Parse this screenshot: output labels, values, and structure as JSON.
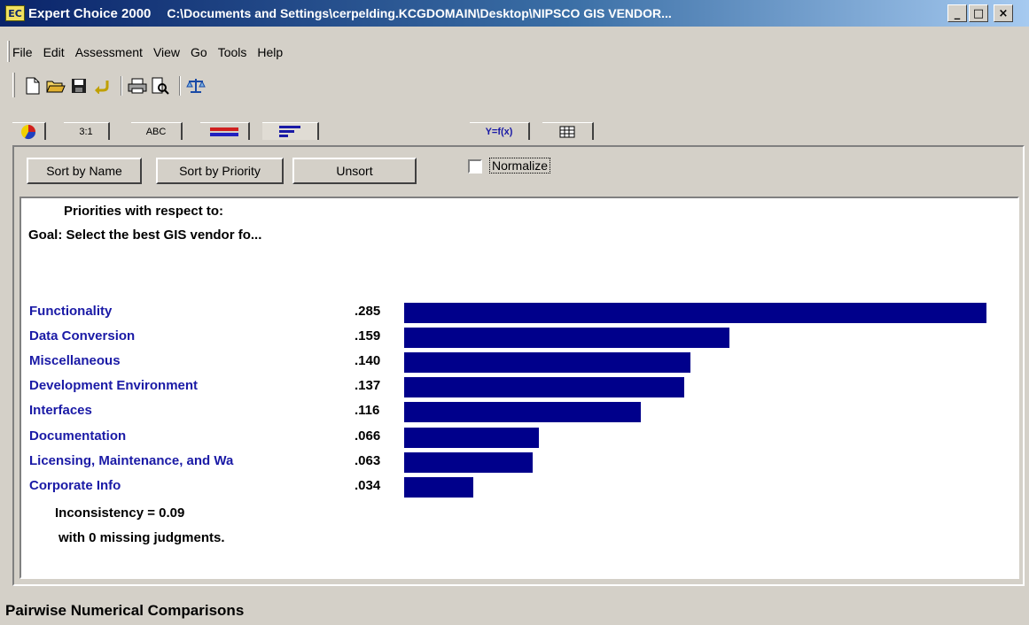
{
  "window": {
    "app_name": "Expert Choice 2000",
    "path": "C:\\Documents and Settings\\cerpelding.KCGDOMAIN\\Desktop\\NIPSCO GIS VENDOR...",
    "icon_label": "EC",
    "minimize": "_",
    "maximize": "□",
    "close": "×"
  },
  "menu": [
    "File",
    "Edit",
    "Assessment",
    "View",
    "Go",
    "Tools",
    "Help"
  ],
  "tabs": {
    "ratio": "3:1",
    "verbal": "ABC",
    "graphical_label": "",
    "formula": "Y=f(x)"
  },
  "sort": {
    "by_name": "Sort by Name",
    "by_priority": "Sort by Priority",
    "unsort": "Unsort",
    "normalize": "Normalize"
  },
  "priorities": {
    "heading": "Priorities with respect to:",
    "goal": "Goal: Select the best GIS vendor fo...",
    "items": [
      {
        "name": "Functionality",
        "value": ".285",
        "fraction": 0.285
      },
      {
        "name": "Data Conversion",
        "value": ".159",
        "fraction": 0.159
      },
      {
        "name": "Miscellaneous",
        "value": ".140",
        "fraction": 0.14
      },
      {
        "name": "Development Environment",
        "value": ".137",
        "fraction": 0.137
      },
      {
        "name": "Interfaces",
        "value": ".116",
        "fraction": 0.116
      },
      {
        "name": "Documentation",
        "value": ".066",
        "fraction": 0.066
      },
      {
        "name": "Licensing, Maintenance, and Wa",
        "value": ".063",
        "fraction": 0.063
      },
      {
        "name": "Corporate Info",
        "value": ".034",
        "fraction": 0.034
      }
    ],
    "inconsistency": "Inconsistency = 0.09",
    "missing": "with 0  missing judgments.",
    "bar_color": "#00008b"
  },
  "status": "Pairwise Numerical Comparisons"
}
